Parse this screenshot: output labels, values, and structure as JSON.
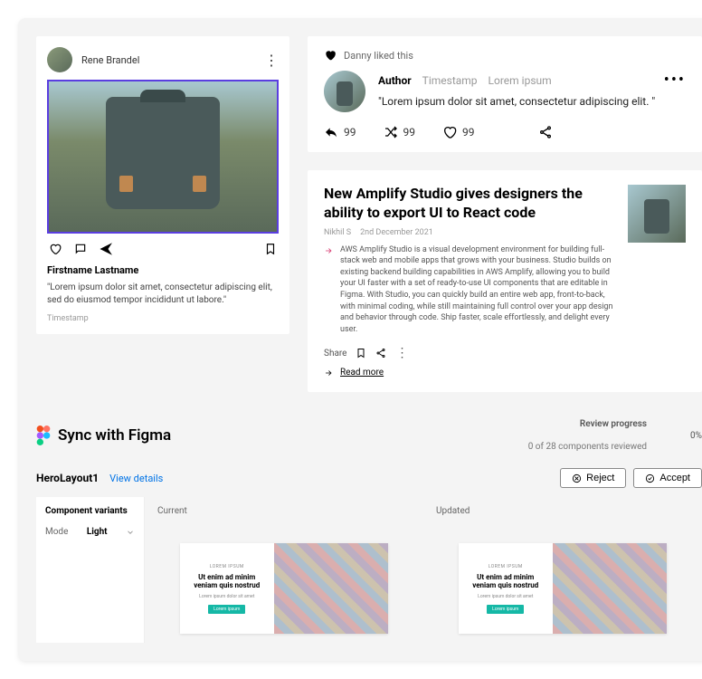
{
  "post": {
    "author": "Rene Brandel",
    "name": "Firstname Lastname",
    "body": "\"Lorem ipsum dolor sit amet, consectetur adipiscing elit, sed do eiusmod tempor incididunt ut labore.\"",
    "timestamp": "Timestamp"
  },
  "comment": {
    "liked_by": "Danny liked this",
    "author": "Author",
    "timestamp": "Timestamp",
    "extra": "Lorem ipsum",
    "text": "\"Lorem ipsum dolor sit amet, consectetur adipiscing elit. \"",
    "reply_count": "99",
    "shuffle_count": "99",
    "like_count": "99"
  },
  "article": {
    "title": "New Amplify Studio gives designers the ability to export UI to React code",
    "author": "Nikhil S",
    "date": "2nd December 2021",
    "body": "AWS Amplify Studio is a visual development environment for building full-stack web and mobile apps that grows with your business. Studio builds on existing backend building capabilities in AWS Amplify, allowing you to build your UI faster with a set of ready-to-use UI components that are editable in Figma. With Studio, you can quickly build an entire web app, front-to-back, with minimal coding, while still maintaining full control over your app design and behavior through code. Ship faster, scale effortlessly, and delight every user.",
    "share_label": "Share",
    "readmore": "Read more"
  },
  "sync": {
    "title": "Sync with Figma",
    "review_label": "Review progress",
    "review_count": "0 of 28 components reviewed",
    "percent": "0%",
    "component_name": "HeroLayout1",
    "view_details": "View details",
    "reject": "Reject",
    "accept": "Accept",
    "variants_title": "Component variants",
    "variant_mode_label": "Mode",
    "variant_mode_value": "Light",
    "current_label": "Current",
    "updated_label": "Updated",
    "preview": {
      "eyebrow": "LOREM IPSUM",
      "heading": "Ut enim ad minim veniam quis nostrud",
      "sub": "Lorem ipsum dolor sit amet",
      "cta": "Lorem ipsum"
    }
  }
}
